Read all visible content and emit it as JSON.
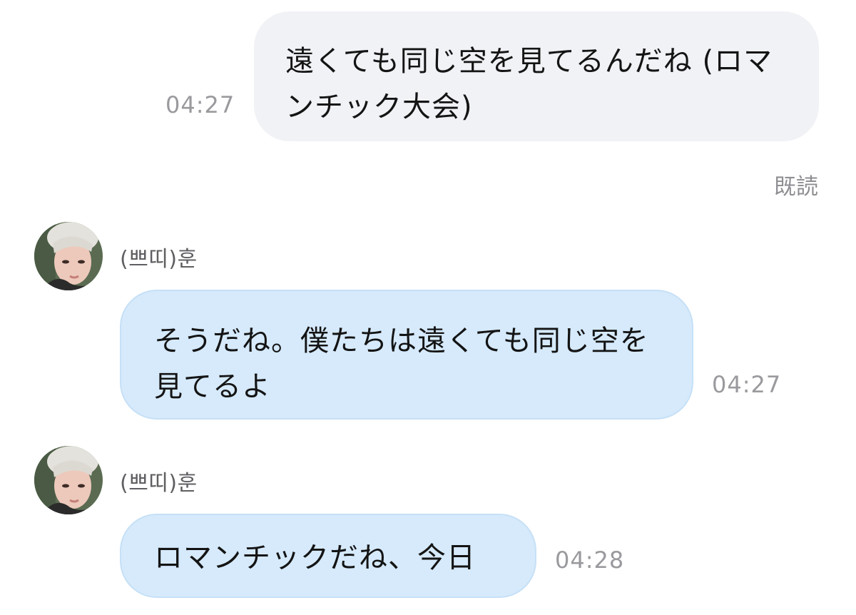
{
  "messages": [
    {
      "direction": "outgoing",
      "text": "遠くても同じ空を見てるんだね (ロマンチック大会)",
      "time": "04:27",
      "status": "既読"
    },
    {
      "direction": "incoming",
      "sender": "(쁘띠)훈",
      "text": "そうだね。僕たちは遠くても同じ空を見てるよ",
      "time": "04:27"
    },
    {
      "direction": "incoming",
      "sender": "(쁘띠)훈",
      "text": "ロマンチックだね、今日",
      "time": "04:28"
    }
  ],
  "colors": {
    "outgoing_bubble": "#f1f2f6",
    "incoming_bubble": "#d6eafc",
    "timestamp": "#9a9a9e",
    "sender_name": "#5f5f63"
  },
  "icons": {
    "avatar": "profile-photo-avatar"
  }
}
